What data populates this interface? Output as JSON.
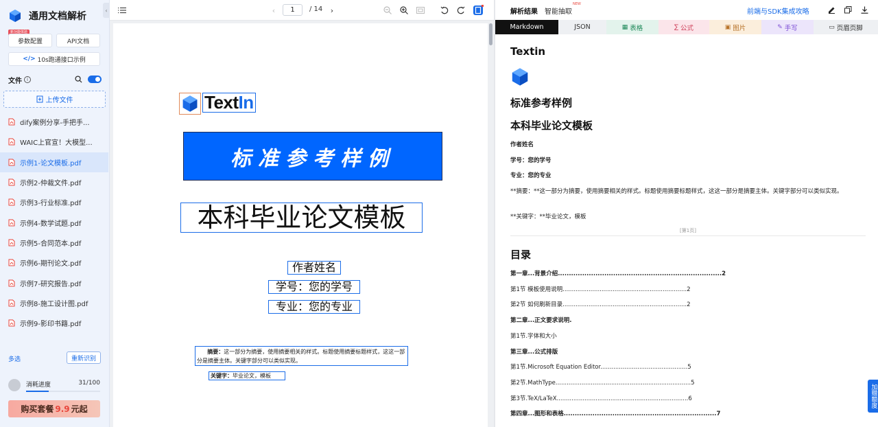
{
  "sidebar": {
    "app_title": "通用文档解析",
    "new_badge": "新功能体验",
    "param_button": "参数配置",
    "api_button": "API文档",
    "demo_button": "10s跑通接口示例",
    "files_label": "文件",
    "upload_label": "上传文件",
    "files": [
      {
        "name": "dify案例分享-手把手..."
      },
      {
        "name": "WAIC上官宣！大模型..."
      },
      {
        "name": "示例1-论文模板.pdf"
      },
      {
        "name": "示例2-仲裁文件.pdf"
      },
      {
        "name": "示例3-行业标准.pdf"
      },
      {
        "name": "示例4-数学试题.pdf"
      },
      {
        "name": "示例5-合同范本.pdf"
      },
      {
        "name": "示例6-期刊论文.pdf"
      },
      {
        "name": "示例7-研究报告.pdf"
      },
      {
        "name": "示例8-施工设计图.pdf"
      },
      {
        "name": "示例9-影印书籍.pdf"
      }
    ],
    "active_file_index": 2,
    "multi_select": "多选",
    "rerecognize": "重新识别",
    "usage_label": "消耗进度",
    "usage_count": "31/100",
    "usage_fraction": 0.31,
    "buy_prefix": "购买套餐",
    "buy_price": "9.9",
    "buy_suffix": "元起"
  },
  "viewer": {
    "current_page": "1",
    "total_pages": "/ 14",
    "doc": {
      "logo_text_a": "Text",
      "logo_text_b": "In",
      "banner": "标准参考样例",
      "title": "本科毕业论文模板",
      "author": "作者姓名",
      "student_id": "学号：您的学号",
      "major": "专业：您的专业",
      "abstract_label": "摘要：",
      "abstract_text": "这一部分为摘要，使用摘要相关的样式。标题使用摘要标题样式，这这一部分是摘要主体。关键字部分可以类似实现。",
      "keyword_label": "关键字：",
      "keyword_text": "毕业论文，模板"
    }
  },
  "right": {
    "tab_result": "解析结果",
    "tab_extract": "智能抽取",
    "new_mark": "NEW",
    "sdk_link": "前端与SDK集成攻略",
    "format_tabs": [
      {
        "label": "Markdown",
        "bg": "#111111",
        "color": "#ffffff",
        "icon": ""
      },
      {
        "label": "JSON",
        "bg": "#eef0f3",
        "color": "#333333",
        "icon": ""
      },
      {
        "label": "表格",
        "bg": "#e3f3ec",
        "color": "#1f8a5a",
        "icon": "▦"
      },
      {
        "label": "公式",
        "bg": "#fbe5ea",
        "color": "#d0455f",
        "icon": "∑"
      },
      {
        "label": "图片",
        "bg": "#fbeedc",
        "color": "#b8742a",
        "icon": "▣"
      },
      {
        "label": "手写",
        "bg": "#ece5fb",
        "color": "#7d4fd6",
        "icon": "✎"
      },
      {
        "label": "页眉页脚",
        "bg": "#eef0f3",
        "color": "#333333",
        "icon": "▭"
      }
    ],
    "content": {
      "h_textin": "Textin",
      "h_sample": "标准参考样例",
      "h_template": "本科毕业论文模板",
      "author": "作者姓名",
      "student_id": "学号：您的学号",
      "major": "专业：您的专业",
      "abstract": "**摘要：**这一部分为摘要，使用摘要相关的样式。标题使用摘要标题样式，这这一部分是摘要主体。关键字部分可以类似实现。",
      "keywords": "**关键字：**毕业论文，模板",
      "page_mark": "[第1页]",
      "toc_title": "目录",
      "toc": [
        {
          "text": "第一章...背景介绍..........................................................................2",
          "bold": true
        },
        {
          "text": "第1节 模板使用说明...................................................................2",
          "bold": false
        },
        {
          "text": "第2节 如何刷新目录...................................................................2",
          "bold": false
        },
        {
          "text": "第二章...正文要求说明.",
          "bold": true
        },
        {
          "text": "第1节.字体和大小",
          "bold": false
        },
        {
          "text": "第三章...公式排版",
          "bold": true
        },
        {
          "text": "第1节.Microsoft Equation Editor...............................................5",
          "bold": false
        },
        {
          "text": "第2节.MathType.........................................................................5",
          "bold": false
        },
        {
          "text": "第3节.TeX/LaTeX.......................................................................6",
          "bold": false
        },
        {
          "text": "第四章...图形和表格.....................................................................7",
          "bold": true
        }
      ]
    },
    "float_button": "加赠额度"
  }
}
